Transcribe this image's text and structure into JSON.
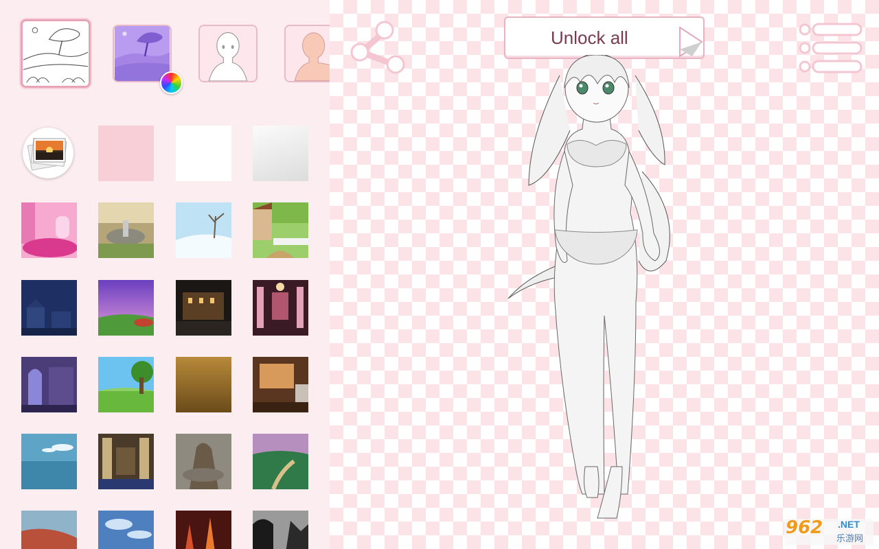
{
  "toolbar": {
    "unlock_label": "Unlock all",
    "share_icon": "share-icon",
    "menu_icon": "hamburger-menu-icon"
  },
  "categories": [
    {
      "name": "background-line-art",
      "selected": true
    },
    {
      "name": "background-color",
      "selected": false
    },
    {
      "name": "body-outline",
      "selected": false
    },
    {
      "name": "body-skin",
      "selected": false
    }
  ],
  "backgrounds": [
    "gallery",
    "pink",
    "white",
    "light-gray",
    "pink-bedroom",
    "fountain-garden",
    "snowy-tree",
    "village-house",
    "night-town",
    "purple-sky-field",
    "night-castle",
    "pink-temple-hall",
    "cathedral-interior",
    "green-meadow-tree",
    "golden-haze",
    "sunset-room",
    "blue-sky-clouds",
    "grand-hall",
    "stone-ruins",
    "valley-river",
    "red-flames-field",
    "blue-sky-bridge",
    "burning-city",
    "dark-forest-silhouette"
  ],
  "watermark": {
    "brand": "962",
    "net": ".NET",
    "sub": "乐游网"
  },
  "colors": {
    "panel_bg": "#fcedf0",
    "accent": "#e8a3b7",
    "checker": "#fbe3e8",
    "text": "#7a3a50"
  }
}
